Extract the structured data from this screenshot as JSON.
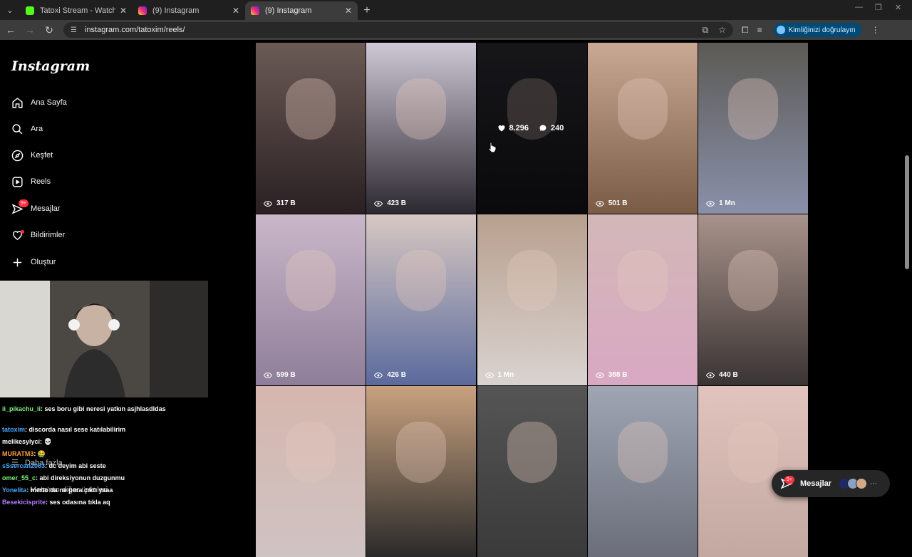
{
  "browser": {
    "tabs": [
      {
        "title": "Tatoxi Stream - Watch Live on K",
        "favicon_color": "#53fc18",
        "active": false
      },
      {
        "title": "(9) Instagram",
        "favicon_color": "#e1306c",
        "active": false
      },
      {
        "title": "(9) Instagram",
        "favicon_color": "#e1306c",
        "active": true
      }
    ],
    "url": "instagram.com/tatoxim/reels/",
    "verify_label": "Kimliğinizi doğrulayın"
  },
  "sidebar": {
    "logo": "Instagram",
    "items": [
      {
        "label": "Ana Sayfa",
        "icon": "home-icon"
      },
      {
        "label": "Ara",
        "icon": "search-icon"
      },
      {
        "label": "Keşfet",
        "icon": "compass-icon"
      },
      {
        "label": "Reels",
        "icon": "reels-icon"
      },
      {
        "label": "Mesajlar",
        "icon": "messenger-icon",
        "badge": "9+"
      },
      {
        "label": "Bildirimler",
        "icon": "heart-icon",
        "dot": true
      },
      {
        "label": "Oluştur",
        "icon": "plus-icon"
      }
    ],
    "more_label": "Daha fazla",
    "meta_label": "Meta'nın diğer ürünleri"
  },
  "chat": [
    {
      "user": "ii_pikachu_ii",
      "color": "#7cf27c",
      "text": "ses boru gibi neresi yatkın asjhlasdldas"
    },
    {
      "user": "tatoxim",
      "color": "#4aa8ff",
      "text": "discorda nasıl sese katılabilirim"
    },
    {
      "user": "melikesylyci",
      "color": "#ffffff",
      "text": "💀"
    },
    {
      "user": "MURATM3",
      "color": "#ff9f40",
      "text": "🤮"
    },
    {
      "user": "sSsercan2063",
      "color": "#4aa8ff",
      "text": "dc deyim abi seste"
    },
    {
      "user": "omer_55_c",
      "color": "#7cf27c",
      "text": "abi direksiyonun duzgunmu"
    },
    {
      "user": "Yonelita",
      "color": "#4aa8ff",
      "text": "merto da ne para çıktı yaaa"
    },
    {
      "user": "Besekicisprite",
      "color": "#b07cff",
      "text": "ses odasına tıkla aq"
    }
  ],
  "reels": [
    {
      "views": "317 B",
      "bg": [
        "#6b5a55",
        "#2a2023"
      ]
    },
    {
      "views": "423 B",
      "bg": [
        "#cfc8d6",
        "#2c2830"
      ]
    },
    {
      "views": "",
      "bg": [
        "#2a2a30",
        "#121216"
      ],
      "hover": {
        "likes": "8.296",
        "comments": "240"
      }
    },
    {
      "views": "501 B",
      "bg": [
        "#c9a994",
        "#7a5b45"
      ]
    },
    {
      "views": "1 Mn",
      "bg": [
        "#5c5a55",
        "#8a90aa"
      ]
    },
    {
      "views": "599 B",
      "bg": [
        "#c9b7c9",
        "#8f7e99"
      ]
    },
    {
      "views": "426 B",
      "bg": [
        "#d7c8c2",
        "#5b6a9c"
      ]
    },
    {
      "views": "1 Mn",
      "bg": [
        "#b8a08f",
        "#d9d3d0"
      ]
    },
    {
      "views": "388 B",
      "bg": [
        "#d2b8b8",
        "#d9a8c2"
      ]
    },
    {
      "views": "440 B",
      "bg": [
        "#a8928a",
        "#3a3434"
      ]
    },
    {
      "views": "",
      "bg": [
        "#d6b6ae",
        "#cfc3c3"
      ]
    },
    {
      "views": "",
      "bg": [
        "#c9a27f",
        "#2a2a2a"
      ]
    },
    {
      "views": "",
      "bg": [
        "#555555",
        "#3a3a3a"
      ]
    },
    {
      "views": "",
      "bg": [
        "#9fa5b3",
        "#6b6e7a"
      ]
    },
    {
      "views": "",
      "bg": [
        "#e0c4bd",
        "#c3a7a1"
      ]
    }
  ],
  "messages_pill": {
    "label": "Mesajlar",
    "badge": "9+"
  },
  "colors": {
    "accent_badge": "#ff3040",
    "bg": "#000000"
  }
}
